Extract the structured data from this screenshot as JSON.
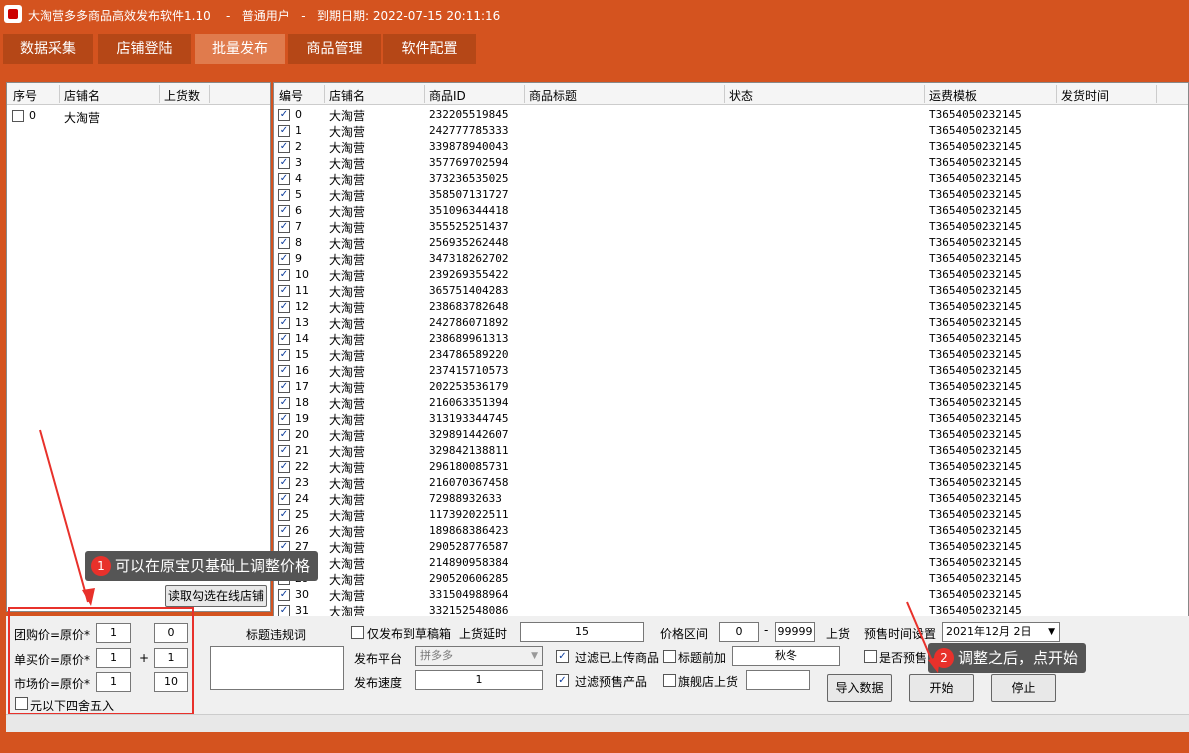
{
  "titlebar": {
    "text": "大淘营多多商品高效发布软件1.10    -   普通用户   -   到期日期: 2022-07-15 20:11:16"
  },
  "menu": [
    "数据采集",
    "店铺登陆",
    "批量发布",
    "商品管理",
    "软件配置"
  ],
  "stores_panel": {
    "headers": [
      "序号",
      "店铺名",
      "上货数"
    ],
    "rows": [
      {
        "index": "0",
        "name": "大淘营",
        "count": ""
      }
    ]
  },
  "goods_panel": {
    "headers": [
      "编号",
      "店铺名",
      "商品ID",
      "商品标题",
      "状态",
      "运费模板",
      "发货时间"
    ],
    "store_name": "大淘营",
    "template": "T3654050232145",
    "ids": [
      "232205519845",
      "242777785333",
      "339878940043",
      "357769702594",
      "373236535025",
      "358507131727",
      "351096344418",
      "355525251437",
      "256935262448",
      "347318262702",
      "239269355422",
      "365751404283",
      "238683782648",
      "242786071892",
      "238689961313",
      "234786589220",
      "237415710573",
      "202253536179",
      "216063351394",
      "313193344745",
      "329891442607",
      "329842138811",
      "296180085731",
      "216070367458",
      "72988932633",
      "117392022511",
      "189868386423",
      "290528776587",
      "214890958384",
      "290520606285",
      "331504988964",
      "332152548086"
    ]
  },
  "annotations": {
    "a1": {
      "num": "1",
      "text": "可以在原宝贝基础上调整价格"
    },
    "a2": {
      "num": "2",
      "text": "调整之后，点开始"
    }
  },
  "controls": {
    "read_store_button": "读取勾选在线店铺",
    "group_price_label": "团购价=原价*",
    "group_price_mult": "1",
    "group_price_add": "0",
    "single_price_label": "单买价=原价*",
    "single_price_mult": "1",
    "single_price_plus": "+",
    "single_price_add": "1",
    "market_price_label": "市场价=原价*",
    "market_price_mult": "1",
    "market_price_add": "10",
    "round_label": "元以下四舍五入",
    "banned_words_label": "标题违规词",
    "draft_only_label": "仅发布到草稿箱",
    "upload_delay_label": "上货延时",
    "upload_delay_value": "15",
    "price_range_label": "价格区间",
    "price_min": "0",
    "price_dash": "-",
    "price_max": "99999",
    "price_suffix": "上货",
    "presale_time_label": "预售时间设置",
    "presale_date": "2021年12月  2日",
    "platform_label": "发布平台",
    "platform_value": "拼多多",
    "filter_uploaded_label": "过滤已上传商品",
    "title_prefix_label": "标题前加",
    "title_prefix_value": "秋冬",
    "is_presale_label": "是否预售",
    "speed_label": "发布速度",
    "speed_value": "1",
    "filter_presale_label": "过滤预售产品",
    "flagship_label": "旗舰店上货",
    "flagship_value": "",
    "import_button": "导入数据",
    "start_button": "开始",
    "stop_button": "停止"
  }
}
